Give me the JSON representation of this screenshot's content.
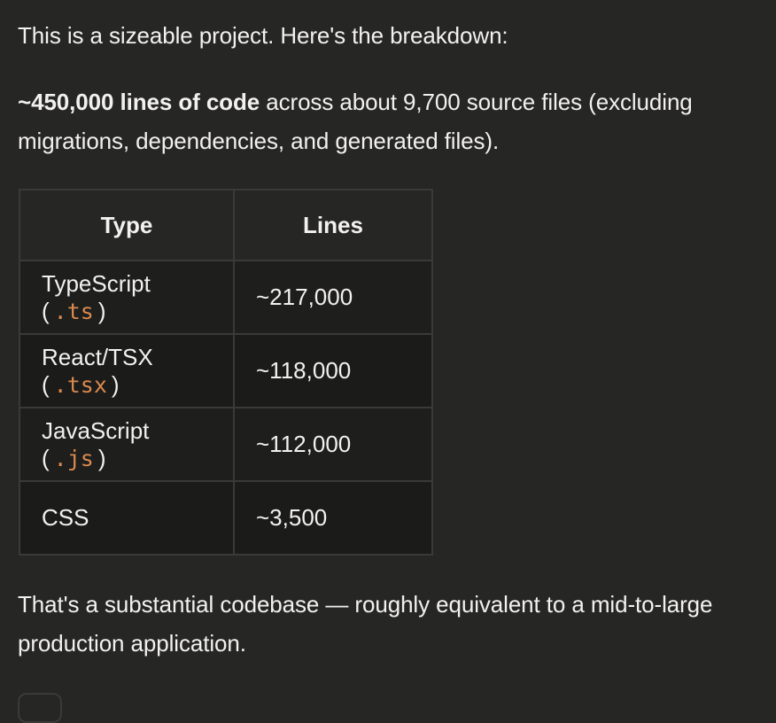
{
  "intro": "This is a sizeable project. Here's the breakdown:",
  "summary": {
    "bold": "~450,000 lines of code",
    "rest": " across about 9,700 source files (excluding migrations, dependencies, and generated files)."
  },
  "table": {
    "headers": [
      "Type",
      "Lines"
    ],
    "rows": [
      {
        "label": "TypeScript",
        "ext": ".ts",
        "lines": "~217,000"
      },
      {
        "label": "React/TSX",
        "ext": ".tsx",
        "lines": "~118,000"
      },
      {
        "label": "JavaScript",
        "ext": ".js",
        "lines": "~112,000"
      },
      {
        "label": "CSS",
        "ext": "",
        "lines": "~3,500"
      }
    ]
  },
  "conclusion": "That's a substantial codebase — roughly equivalent to a mid-to-large production application.",
  "colors": {
    "background": "#262625",
    "text": "#f2f1ee",
    "code": "#d98a4e",
    "border": "#3a3a38"
  }
}
